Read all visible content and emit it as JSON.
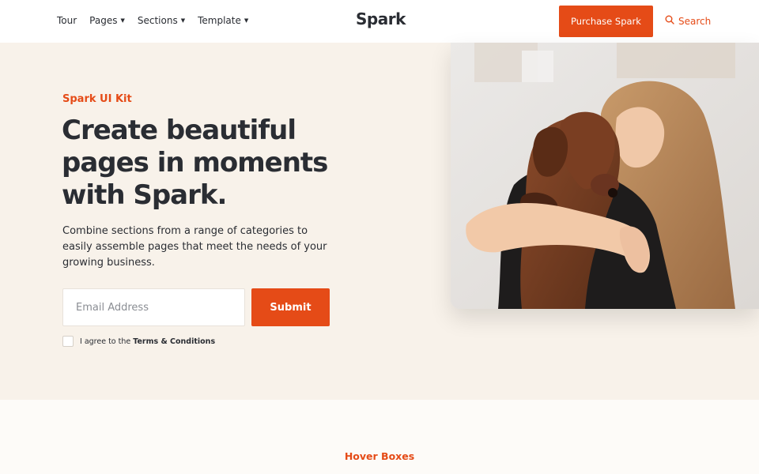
{
  "header": {
    "nav": [
      {
        "label": "Tour",
        "has_caret": false
      },
      {
        "label": "Pages",
        "has_caret": true
      },
      {
        "label": "Sections",
        "has_caret": true
      },
      {
        "label": "Template",
        "has_caret": true
      }
    ],
    "logo": "Spark",
    "purchase_label": "Purchase Spark",
    "search_label": "Search",
    "search_icon": "search-icon"
  },
  "hero": {
    "eyebrow": "Spark UI Kit",
    "headline": "Create beautiful pages in moments with Spark.",
    "subtext": "Combine sections from a range of categories to easily assemble pages that meet the needs of your growing business.",
    "email_placeholder": "Email Address",
    "submit_label": "Submit",
    "terms_prefix": "I agree to the",
    "terms_link": "Terms & Conditions"
  },
  "lower": {
    "section_label": "Hover Boxes"
  },
  "colors": {
    "accent": "#e54b17",
    "hero_bg": "#f8f2ea",
    "text": "#2a2d33"
  }
}
